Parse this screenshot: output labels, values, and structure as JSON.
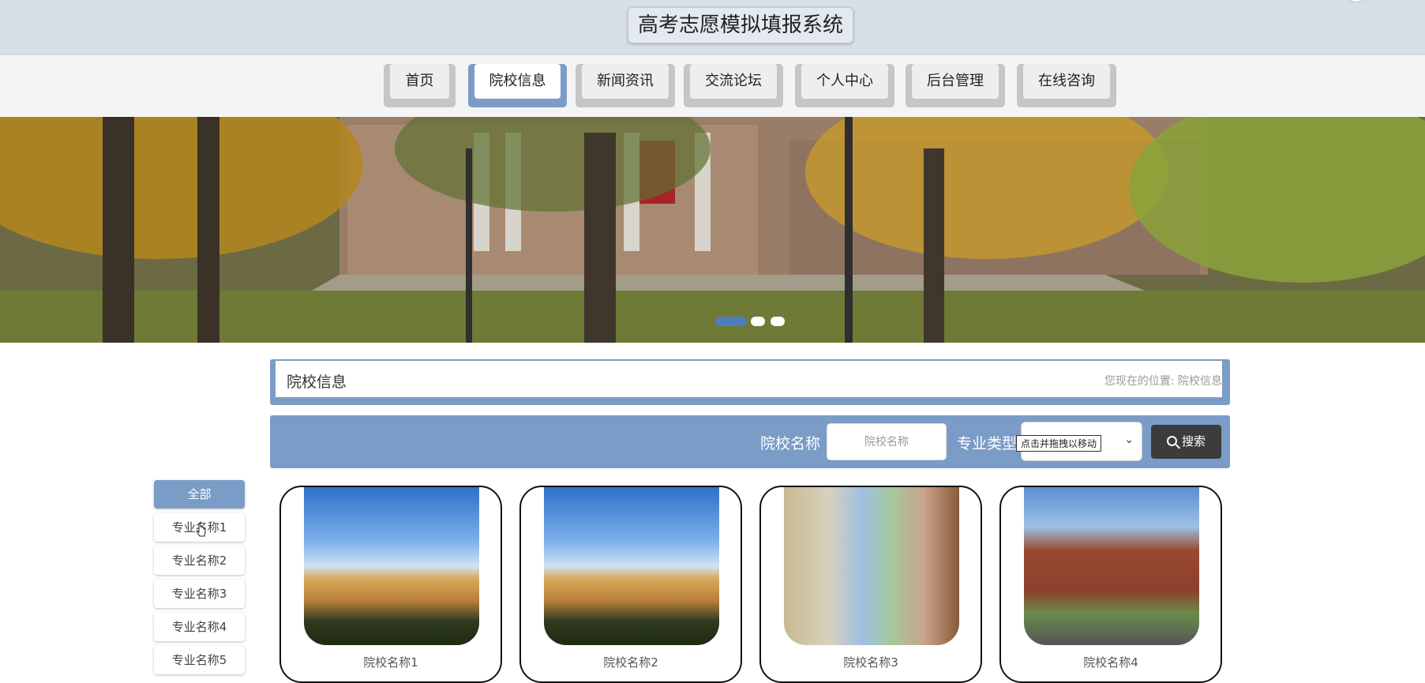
{
  "header": {
    "title": "高考志愿模拟填报系统"
  },
  "nav": {
    "items": [
      {
        "label": "首页",
        "active": false
      },
      {
        "label": "院校信息",
        "active": true
      },
      {
        "label": "新闻资讯",
        "active": false
      },
      {
        "label": "交流论坛",
        "active": false
      },
      {
        "label": "个人中心",
        "active": false
      },
      {
        "label": "后台管理",
        "active": false
      },
      {
        "label": "在线咨询",
        "active": false
      }
    ]
  },
  "banner": {
    "slides": 3,
    "active_slide": 1
  },
  "page": {
    "title": "院校信息",
    "location_prefix": "您现在的位置:",
    "location": "院校信息"
  },
  "search": {
    "name_label": "院校名称",
    "name_placeholder": "院校名称",
    "type_label": "专业类型",
    "drag_tip": "点击并拖拽以移动",
    "button_label": "搜索"
  },
  "categories": [
    {
      "label": "全部",
      "active": true
    },
    {
      "label": "专业名称1",
      "active": false
    },
    {
      "label": "专业名称2",
      "active": false
    },
    {
      "label": "专业名称3",
      "active": false
    },
    {
      "label": "专业名称4",
      "active": false
    },
    {
      "label": "专业名称5",
      "active": false
    }
  ],
  "schools": [
    {
      "name": "院校名称1"
    },
    {
      "name": "院校名称2"
    },
    {
      "name": "院校名称3"
    },
    {
      "name": "院校名称4"
    }
  ],
  "colors": {
    "accent": "#7b9cc6",
    "header_bg": "#d6dfe8",
    "button_dark": "#3c3c3c"
  }
}
